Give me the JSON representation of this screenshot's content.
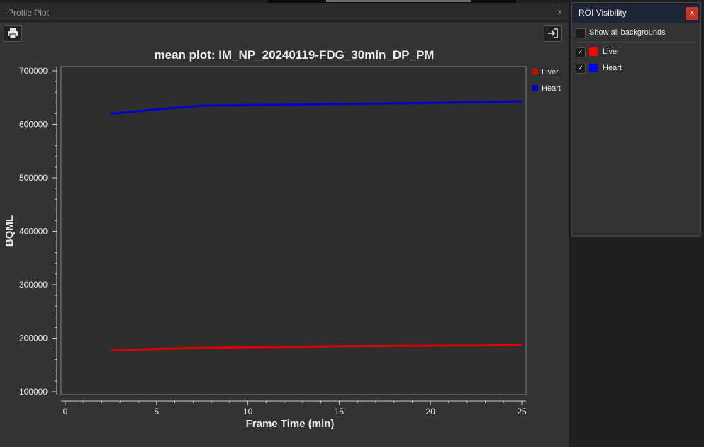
{
  "profile_panel": {
    "title": "Profile Plot",
    "close_label": "x",
    "print_icon": "print-icon",
    "export_icon": "export-icon"
  },
  "roi_panel": {
    "title": "ROI Visibility",
    "close_label": "x",
    "show_backgrounds_label": "Show all backgrounds",
    "show_backgrounds_checked": false,
    "items": [
      {
        "label": "Liver",
        "checked": true,
        "check_mark": "✓",
        "color": "#ff0000"
      },
      {
        "label": "Heart",
        "checked": true,
        "check_mark": "✓",
        "color": "#0000ff"
      }
    ]
  },
  "chart_data": {
    "type": "line",
    "title": "mean plot: IM_NP_20240119-FDG_30min_DP_PM",
    "xlabel": "Frame Time (min)",
    "ylabel": "BQML",
    "xlim": [
      0,
      25
    ],
    "ylim": [
      100000,
      700000
    ],
    "x_ticks": [
      0,
      5,
      10,
      15,
      20,
      25
    ],
    "y_ticks": [
      100000,
      200000,
      300000,
      400000,
      500000,
      600000,
      700000
    ],
    "grid": false,
    "legend": "top-right",
    "series": [
      {
        "name": "Liver",
        "color": "#e00000",
        "x": [
          2.5,
          3.5,
          5,
          7.5,
          10,
          12.5,
          15,
          17.5,
          20,
          22.5,
          25
        ],
        "y": [
          177000,
          178000,
          180000,
          182000,
          183000,
          184000,
          185000,
          185500,
          186000,
          186500,
          187000
        ]
      },
      {
        "name": "Heart",
        "color": "#0000d0",
        "x": [
          2.5,
          3.5,
          5,
          7.5,
          10,
          12.5,
          15,
          17.5,
          20,
          22.5,
          25
        ],
        "y": [
          620000,
          623000,
          628000,
          635000,
          636000,
          637000,
          638000,
          639000,
          640000,
          641500,
          643000
        ]
      }
    ]
  }
}
